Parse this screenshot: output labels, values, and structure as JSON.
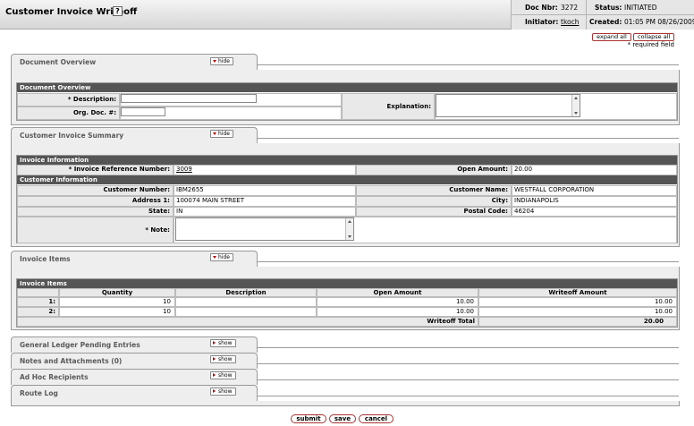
{
  "header": {
    "title": "Customer Invoice Writeoff",
    "help_glyph": "?",
    "doc_nbr_label": "Doc Nbr:",
    "doc_nbr": "3272",
    "status_label": "Status:",
    "status": "INITIATED",
    "initiator_label": "Initiator:",
    "initiator": "tkoch",
    "created_label": "Created:",
    "created": "01:05 PM 08/26/2009"
  },
  "controls": {
    "expand_all": "expand all",
    "collapse_all": "collapse all",
    "required_note": "* required field"
  },
  "doc_overview": {
    "tab_label": "Document Overview",
    "toggle": "hide",
    "bar": "Document Overview",
    "description_label": "* Description:",
    "description_value": "",
    "org_doc_label": "Org. Doc. #:",
    "org_doc_value": "",
    "explanation_label": "Explanation:",
    "explanation_value": ""
  },
  "invoice_summary": {
    "tab_label": "Customer Invoice Summary",
    "toggle": "hide",
    "invoice_info_bar": "Invoice Information",
    "invoice_ref_label": "* Invoice Reference Number:",
    "invoice_ref": "3009",
    "open_amount_label": "Open Amount:",
    "open_amount": "20.00",
    "customer_info_bar": "Customer Information",
    "customer_number_label": "Customer Number:",
    "customer_number": "IBM2655",
    "customer_name_label": "Customer Name:",
    "customer_name": "WESTFALL CORPORATION",
    "address_label": "Address 1:",
    "address": "100074 MAIN STREET",
    "city_label": "City:",
    "city": "INDIANAPOLIS",
    "state_label": "State:",
    "state": "IN",
    "postal_label": "Postal Code:",
    "postal": "46204",
    "note_label": "* Note:",
    "note_value": ""
  },
  "invoice_items": {
    "tab_label": "Invoice Items",
    "toggle": "hide",
    "bar": "Invoice Items",
    "columns": [
      "Quantity",
      "Description",
      "Open Amount",
      "Writeoff Amount"
    ],
    "rows": [
      {
        "idx": "1:",
        "quantity": "10",
        "description": "",
        "open_amount": "10.00",
        "writeoff_amount": "10.00"
      },
      {
        "idx": "2:",
        "quantity": "10",
        "description": "",
        "open_amount": "10.00",
        "writeoff_amount": "10.00"
      }
    ],
    "total_label": "Writeoff Total",
    "total_value": "20.00"
  },
  "collapsed_sections": [
    {
      "label": "General Ledger Pending Entries",
      "toggle": "show"
    },
    {
      "label": "Notes and Attachments (0)",
      "toggle": "show"
    },
    {
      "label": "Ad Hoc Recipients",
      "toggle": "show"
    },
    {
      "label": "Route Log",
      "toggle": "show"
    }
  ],
  "actions": {
    "submit": "submit",
    "save": "save",
    "cancel": "cancel"
  },
  "colors": {
    "section_bar": "#555555",
    "button_border": "#aa3333",
    "toggle_arrow": "#b30000"
  }
}
